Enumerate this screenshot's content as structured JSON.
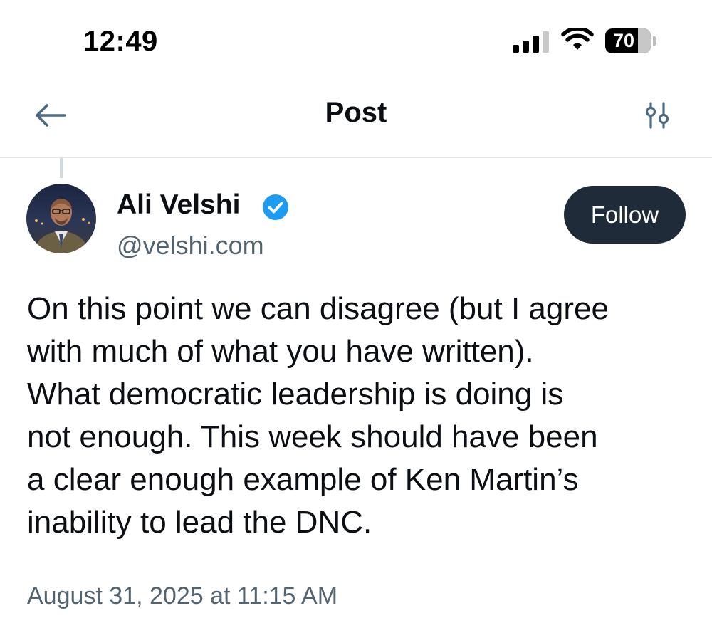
{
  "status_bar": {
    "time": "12:49",
    "battery_level": "70"
  },
  "nav": {
    "title": "Post",
    "back_icon": "arrow-left-icon",
    "settings_icon": "sliders-icon"
  },
  "post": {
    "author": {
      "name": "Ali Velshi",
      "handle": "@velshi.com",
      "verified": true
    },
    "follow_label": "Follow",
    "body_lines": [
      "On this point we can disagree (but I agree",
      "with much of what you have written).",
      "What democratic leadership is doing is",
      "not enough. This week should have been",
      "a clear enough example of Ken Martin’s",
      "inability to lead the DNC."
    ],
    "timestamp": "August 31, 2025 at 11:15 AM"
  },
  "colors": {
    "accent": "#1d9bf0",
    "icon": "#4a6b82",
    "follow_bg": "#1f2b38",
    "secondary_text": "#536471"
  }
}
